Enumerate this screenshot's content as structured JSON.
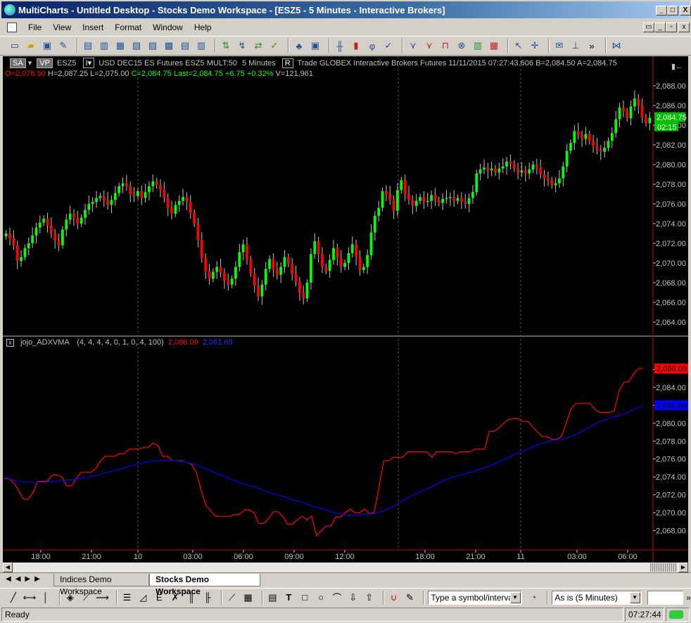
{
  "window": {
    "title": "MultiCharts - Untitled Desktop - Stocks Demo Workspace - [ESZ5 - 5 Minutes - Interactive Brokers]",
    "min": "_",
    "max": "□",
    "close": "X"
  },
  "menu": [
    "File",
    "View",
    "Insert",
    "Format",
    "Window",
    "Help"
  ],
  "chart_header": {
    "sa": "SA",
    "vp": "VP",
    "symbol": "ESZ5",
    "description": "USD DEC15 ES Futures ESZ5 MULT:50",
    "interval": "5 Minutes",
    "r": "R",
    "rest": "Trade  GLOBEX  Interactive Brokers  Futures  11/11/2015  07:27:43.606  B=2,084.50  A=2,084.75",
    "open": "O=2,076.50",
    "high": "H=2,087.25",
    "low": "L=2,075.00",
    "close": "C=2,084.75",
    "last": "Last=2,084.75",
    "change": "+6.75",
    "pct": "+0.32%",
    "volume": "V=121,961"
  },
  "price_tag": {
    "value": "2,084.75",
    "time": "02:15"
  },
  "indicator": {
    "name": "jojo_ADXVMA",
    "params": "(4, 4, 4, 4, 0, 1, 0, 4, 100)",
    "v1": "2,086.09",
    "v2": "2,081.69"
  },
  "tabs": [
    "Indices Demo Workspace",
    "Stocks Demo Workspace"
  ],
  "symbol_input": "Type a symbol/interval",
  "resolution": "As is (5 Minutes)",
  "status": {
    "left": "Ready",
    "time": "07:27:44"
  },
  "colors": {
    "up": "#00ff00",
    "down": "#ff0000",
    "line1": "#ff0000",
    "line2": "#0000ff",
    "bg": "#000000"
  },
  "chart_data": [
    {
      "type": "candlestick",
      "ylim": [
        2063,
        2089
      ],
      "yticks": [
        2064,
        2066,
        2068,
        2070,
        2072,
        2074,
        2076,
        2078,
        2080,
        2082,
        2084,
        2086,
        2088
      ],
      "ytick_labels": [
        "2,064.00",
        "2,066.00",
        "2,068.00",
        "2,070.00",
        "2,072.00",
        "2,074.00",
        "2,076.00",
        "2,078.00",
        "2,080.00",
        "2,082.00",
        "2,084.00",
        "2,086.00",
        "2,088.00"
      ],
      "xtick_labels": [
        "18:00",
        "21:00",
        "10",
        "03:00",
        "06:00",
        "09:00",
        "12:00",
        "18:00",
        "21:00",
        "11",
        "03:00",
        "06:00"
      ],
      "closes": [
        2073.0,
        2072.5,
        2071.8,
        2070.2,
        2070.6,
        2071.5,
        2072.0,
        2072.8,
        2073.6,
        2074.1,
        2074.5,
        2073.8,
        2073.0,
        2072.3,
        2071.8,
        2073.4,
        2074.4,
        2075.0,
        2074.6,
        2074.0,
        2074.6,
        2075.4,
        2076.0,
        2076.2,
        2076.6,
        2076.8,
        2076.4,
        2075.9,
        2076.4,
        2077.1,
        2077.8,
        2078.1,
        2077.8,
        2077.0,
        2076.8,
        2077.3,
        2076.6,
        2077.2,
        2077.8,
        2078.3,
        2077.9,
        2077.4,
        2076.6,
        2075.6,
        2075.0,
        2075.9,
        2076.3,
        2076.7,
        2076.2,
        2075.1,
        2074.0,
        2072.3,
        2070.5,
        2069.2,
        2068.4,
        2069.1,
        2069.6,
        2069.0,
        2068.2,
        2067.8,
        2068.4,
        2069.6,
        2071.1,
        2071.9,
        2070.4,
        2068.9,
        2067.7,
        2066.6,
        2067.8,
        2069.4,
        2070.4,
        2069.3,
        2068.8,
        2069.6,
        2070.6,
        2069.9,
        2068.9,
        2068.1,
        2067.0,
        2066.4,
        2068.0,
        2070.9,
        2072.2,
        2070.9,
        2069.6,
        2069.2,
        2070.3,
        2071.5,
        2070.6,
        2069.6,
        2070.0,
        2071.0,
        2071.9,
        2070.6,
        2069.3,
        2069.6,
        2070.8,
        2073.1,
        2074.8,
        2075.6,
        2077.3,
        2077.0,
        2076.4,
        2075.3,
        2077.4,
        2078.4,
        2077.0,
        2076.4,
        2075.8,
        2076.3,
        2076.7,
        2076.2,
        2076.3,
        2076.9,
        2076.4,
        2076.1,
        2076.5,
        2076.6,
        2076.7,
        2076.3,
        2076.6,
        2076.2,
        2076.0,
        2076.6,
        2077.2,
        2079.1,
        2079.5,
        2079.7,
        2079.4,
        2079.6,
        2079.2,
        2079.6,
        2079.8,
        2080.3,
        2080.1,
        2079.6,
        2079.2,
        2079.4,
        2079.1,
        2079.5,
        2080.0,
        2079.7,
        2079.0,
        2078.6,
        2078.4,
        2077.9,
        2078.1,
        2078.6,
        2079.8,
        2081.4,
        2082.2,
        2083.4,
        2083.0,
        2082.6,
        2083.1,
        2082.4,
        2081.9,
        2081.5,
        2081.3,
        2081.7,
        2082.4,
        2083.2,
        2084.6,
        2085.8,
        2085.4,
        2084.7,
        2085.9,
        2086.7,
        2086.0,
        2084.8,
        2084.2,
        2084.75
      ]
    },
    {
      "type": "line",
      "ylim": [
        2066,
        2088
      ],
      "yticks": [
        2068,
        2070,
        2072,
        2074,
        2076,
        2078,
        2080,
        2082,
        2084,
        2086
      ],
      "ytick_labels": [
        "2,068.00",
        "2,070.00",
        "2,072.00",
        "2,074.00",
        "2,076.00",
        "2,078.00",
        "2,080.00",
        "2,082.00",
        "2,084.00",
        "2,086.00"
      ],
      "series": [
        {
          "name": "jojo_ADXVMA",
          "values": [
            2073.8,
            2073.8,
            2073.3,
            2072.5,
            2071.5,
            2071.5,
            2072.3,
            2073.5,
            2073.5,
            2073.5,
            2074.2,
            2074.2,
            2074.0,
            2073.0,
            2073.0,
            2073.8,
            2074.5,
            2074.5,
            2074.5,
            2074.9,
            2075.7,
            2076.3,
            2076.3,
            2076.3,
            2076.6,
            2076.6,
            2077.1,
            2077.1,
            2077.1,
            2077.3,
            2077.3,
            2077.8,
            2077.5,
            2076.3,
            2076.3,
            2075.8,
            2075.8,
            2075.8,
            2075.6,
            2075.4,
            2074.5,
            2072.5,
            2070.8,
            2070.2,
            2069.6,
            2069.6,
            2069.6,
            2069.6,
            2069.8,
            2069.8,
            2070.3,
            2070.3,
            2070.0,
            2068.8,
            2068.8,
            2069.3,
            2070.1,
            2070.1,
            2069.6,
            2068.7,
            2068.7,
            2069.2,
            2069.6,
            2069.2,
            2069.6,
            2067.4,
            2068.0,
            2068.5,
            2068.5,
            2069.5,
            2069.5,
            2070.0,
            2070.4,
            2070.0,
            2070.0,
            2070.4,
            2069.9,
            2070.0,
            2072.8,
            2075.8,
            2075.8,
            2076.2,
            2076.2,
            2076.2,
            2076.8,
            2076.8,
            2076.8,
            2076.8,
            2076.8,
            2076.2,
            2076.8,
            2076.8,
            2076.8,
            2076.8,
            2076.6,
            2076.8,
            2076.8,
            2076.8,
            2077.1,
            2077.1,
            2077.1,
            2079.1,
            2079.1,
            2079.5,
            2080.0,
            2080.4,
            2080.5,
            2080.5,
            2080.2,
            2080.2,
            2079.6,
            2079.0,
            2078.5,
            2078.5,
            2078.2,
            2078.2,
            2078.5,
            2080.0,
            2081.6,
            2082.2,
            2082.2,
            2082.2,
            2082.2,
            2081.5,
            2081.2,
            2081.2,
            2081.2,
            2081.4,
            2083.6,
            2084.6,
            2084.6,
            2085.5,
            2086.1,
            2086.1
          ]
        },
        {
          "name": "2,081.69",
          "values": [
            2074.0,
            2073.6,
            2073.4,
            2073.4,
            2073.4,
            2073.5,
            2073.6,
            2073.7,
            2073.9,
            2074.1,
            2074.4,
            2074.7,
            2075.0,
            2075.3,
            2075.6,
            2075.8,
            2075.8,
            2075.8,
            2075.7,
            2075.4,
            2075.0,
            2074.5,
            2074.1,
            2073.6,
            2073.2,
            2072.9,
            2072.5,
            2072.1,
            2071.8,
            2071.4,
            2071.1,
            2070.7,
            2070.4,
            2070.0,
            2069.7,
            2069.7,
            2069.8,
            2069.9,
            2070.2,
            2070.7,
            2071.4,
            2072.0,
            2072.5,
            2073.0,
            2073.6,
            2074.0,
            2074.3,
            2074.6,
            2075.0,
            2075.4,
            2075.9,
            2076.4,
            2076.9,
            2077.4,
            2077.8,
            2078.1,
            2078.2,
            2078.6,
            2079.2,
            2079.8,
            2080.3,
            2080.7,
            2081.0,
            2081.5,
            2082.0
          ]
        }
      ]
    }
  ]
}
